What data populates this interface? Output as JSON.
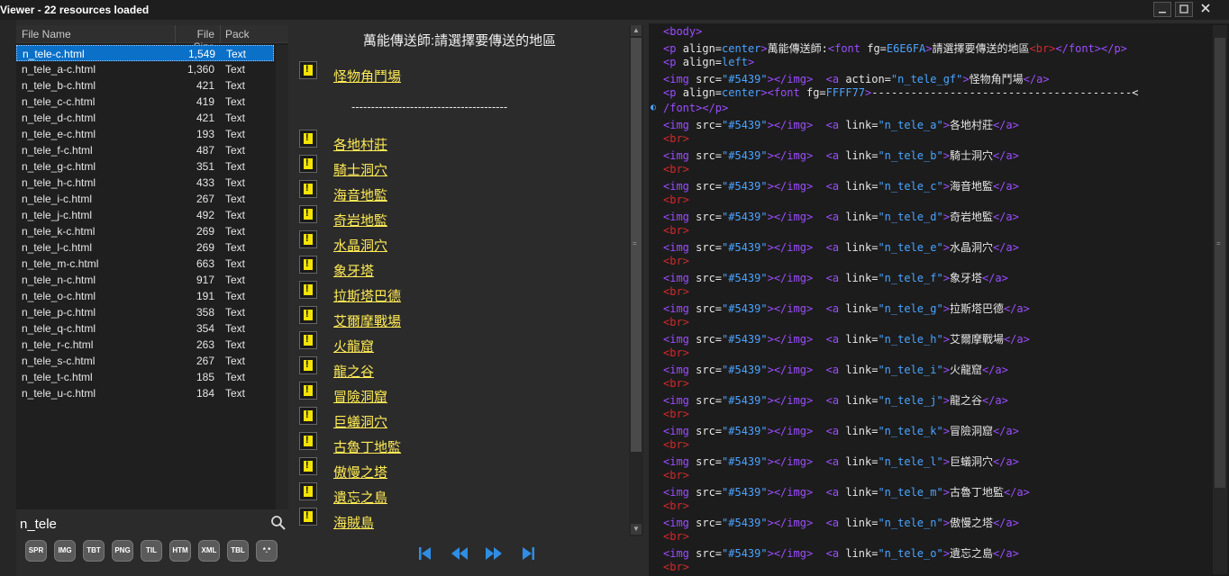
{
  "window": {
    "title": "Viewer - 22 resources loaded"
  },
  "file_list": {
    "columns": [
      "File Name",
      "File Size",
      "Pack"
    ],
    "rows": [
      {
        "name": "n_tele-c.html",
        "size": "1,549",
        "pack": "Text",
        "selected": true
      },
      {
        "name": "n_tele_a-c.html",
        "size": "1,360",
        "pack": "Text"
      },
      {
        "name": "n_tele_b-c.html",
        "size": "421",
        "pack": "Text"
      },
      {
        "name": "n_tele_c-c.html",
        "size": "419",
        "pack": "Text"
      },
      {
        "name": "n_tele_d-c.html",
        "size": "421",
        "pack": "Text"
      },
      {
        "name": "n_tele_e-c.html",
        "size": "193",
        "pack": "Text"
      },
      {
        "name": "n_tele_f-c.html",
        "size": "487",
        "pack": "Text"
      },
      {
        "name": "n_tele_g-c.html",
        "size": "351",
        "pack": "Text"
      },
      {
        "name": "n_tele_h-c.html",
        "size": "433",
        "pack": "Text"
      },
      {
        "name": "n_tele_i-c.html",
        "size": "267",
        "pack": "Text"
      },
      {
        "name": "n_tele_j-c.html",
        "size": "492",
        "pack": "Text"
      },
      {
        "name": "n_tele_k-c.html",
        "size": "269",
        "pack": "Text"
      },
      {
        "name": "n_tele_l-c.html",
        "size": "269",
        "pack": "Text"
      },
      {
        "name": "n_tele_m-c.html",
        "size": "663",
        "pack": "Text"
      },
      {
        "name": "n_tele_n-c.html",
        "size": "917",
        "pack": "Text"
      },
      {
        "name": "n_tele_o-c.html",
        "size": "191",
        "pack": "Text"
      },
      {
        "name": "n_tele_p-c.html",
        "size": "358",
        "pack": "Text"
      },
      {
        "name": "n_tele_q-c.html",
        "size": "354",
        "pack": "Text"
      },
      {
        "name": "n_tele_r-c.html",
        "size": "263",
        "pack": "Text"
      },
      {
        "name": "n_tele_s-c.html",
        "size": "267",
        "pack": "Text"
      },
      {
        "name": "n_tele_t-c.html",
        "size": "185",
        "pack": "Text"
      },
      {
        "name": "n_tele_u-c.html",
        "size": "184",
        "pack": "Text"
      }
    ]
  },
  "search": {
    "value": "n_tele"
  },
  "filters": [
    "SPR",
    "IMG",
    "TBT",
    "PNG",
    "TIL",
    "HTM",
    "XML",
    "TBL",
    "*.*"
  ],
  "preview": {
    "header": "萬能傳送師:請選擇要傳送的地區",
    "top_link": "怪物角鬥場",
    "separator": "----------------------------------------",
    "links": [
      "各地村莊",
      "騎士洞穴",
      "海音地監",
      "奇岩地監",
      "水晶洞穴",
      "象牙塔",
      "拉斯塔巴德",
      "艾爾摩戰場",
      "火龍窟",
      "龍之谷",
      "冒險洞窟",
      "巨蟻洞穴",
      "古魯丁地監",
      "傲慢之塔",
      "遺忘之島",
      "海賊島"
    ]
  },
  "source": {
    "lines": [
      [
        [
          "tg",
          "<body>"
        ]
      ],
      [
        [
          "tg",
          "<p "
        ],
        [
          "at",
          "align="
        ],
        [
          "st",
          "center"
        ],
        [
          "tg",
          ">"
        ],
        [
          "at",
          "萬能傳送師:"
        ],
        [
          "tg",
          "<font "
        ],
        [
          "at",
          "fg="
        ],
        [
          "st",
          "E6E6FA"
        ],
        [
          "tg",
          ">"
        ],
        [
          "at",
          "請選擇要傳送的地區"
        ],
        [
          "br",
          "<br>"
        ],
        [
          "tg",
          "</font></p>"
        ]
      ],
      [
        [
          "tg",
          "<p "
        ],
        [
          "at",
          "align="
        ],
        [
          "st",
          "left"
        ],
        [
          "tg",
          ">"
        ]
      ],
      [
        [
          "tg",
          "<img "
        ],
        [
          "at",
          "src="
        ],
        [
          "st",
          "\"#5439\""
        ],
        [
          "tg",
          "></img>"
        ],
        [
          "at",
          "  "
        ],
        [
          "tg",
          "<a "
        ],
        [
          "at",
          "action="
        ],
        [
          "st",
          "\"n_tele_gf\""
        ],
        [
          "tg",
          ">"
        ],
        [
          "at",
          "怪物角鬥場"
        ],
        [
          "tg",
          "</a>"
        ]
      ],
      [
        [
          "tg",
          "<p "
        ],
        [
          "at",
          "align="
        ],
        [
          "st",
          "center"
        ],
        [
          "tg",
          "><font "
        ],
        [
          "at",
          "fg="
        ],
        [
          "st",
          "FFFF77"
        ],
        [
          "tg",
          ">"
        ],
        [
          "at",
          "----------------------------------------<"
        ]
      ],
      [
        [
          "tg",
          "/font></p>"
        ]
      ],
      [
        [
          "tg",
          "<img "
        ],
        [
          "at",
          "src="
        ],
        [
          "st",
          "\"#5439\""
        ],
        [
          "tg",
          "></img>"
        ],
        [
          "at",
          "  "
        ],
        [
          "tg",
          "<a "
        ],
        [
          "at",
          "link="
        ],
        [
          "st",
          "\"n_tele_a\""
        ],
        [
          "tg",
          ">"
        ],
        [
          "at",
          "各地村莊"
        ],
        [
          "tg",
          "</a>"
        ]
      ],
      [
        [
          "br",
          "<br>"
        ]
      ],
      [
        [
          "tg",
          "<img "
        ],
        [
          "at",
          "src="
        ],
        [
          "st",
          "\"#5439\""
        ],
        [
          "tg",
          "></img>"
        ],
        [
          "at",
          "  "
        ],
        [
          "tg",
          "<a "
        ],
        [
          "at",
          "link="
        ],
        [
          "st",
          "\"n_tele_b\""
        ],
        [
          "tg",
          ">"
        ],
        [
          "at",
          "騎士洞穴"
        ],
        [
          "tg",
          "</a>"
        ]
      ],
      [
        [
          "br",
          "<br>"
        ]
      ],
      [
        [
          "tg",
          "<img "
        ],
        [
          "at",
          "src="
        ],
        [
          "st",
          "\"#5439\""
        ],
        [
          "tg",
          "></img>"
        ],
        [
          "at",
          "  "
        ],
        [
          "tg",
          "<a "
        ],
        [
          "at",
          "link="
        ],
        [
          "st",
          "\"n_tele_c\""
        ],
        [
          "tg",
          ">"
        ],
        [
          "at",
          "海音地監"
        ],
        [
          "tg",
          "</a>"
        ]
      ],
      [
        [
          "br",
          "<br>"
        ]
      ],
      [
        [
          "tg",
          "<img "
        ],
        [
          "at",
          "src="
        ],
        [
          "st",
          "\"#5439\""
        ],
        [
          "tg",
          "></img>"
        ],
        [
          "at",
          "  "
        ],
        [
          "tg",
          "<a "
        ],
        [
          "at",
          "link="
        ],
        [
          "st",
          "\"n_tele_d\""
        ],
        [
          "tg",
          ">"
        ],
        [
          "at",
          "奇岩地監"
        ],
        [
          "tg",
          "</a>"
        ]
      ],
      [
        [
          "br",
          "<br>"
        ]
      ],
      [
        [
          "tg",
          "<img "
        ],
        [
          "at",
          "src="
        ],
        [
          "st",
          "\"#5439\""
        ],
        [
          "tg",
          "></img>"
        ],
        [
          "at",
          "  "
        ],
        [
          "tg",
          "<a "
        ],
        [
          "at",
          "link="
        ],
        [
          "st",
          "\"n_tele_e\""
        ],
        [
          "tg",
          ">"
        ],
        [
          "at",
          "水晶洞穴"
        ],
        [
          "tg",
          "</a>"
        ]
      ],
      [
        [
          "br",
          "<br>"
        ]
      ],
      [
        [
          "tg",
          "<img "
        ],
        [
          "at",
          "src="
        ],
        [
          "st",
          "\"#5439\""
        ],
        [
          "tg",
          "></img>"
        ],
        [
          "at",
          "  "
        ],
        [
          "tg",
          "<a "
        ],
        [
          "at",
          "link="
        ],
        [
          "st",
          "\"n_tele_f\""
        ],
        [
          "tg",
          ">"
        ],
        [
          "at",
          "象牙塔"
        ],
        [
          "tg",
          "</a>"
        ]
      ],
      [
        [
          "br",
          "<br>"
        ]
      ],
      [
        [
          "tg",
          "<img "
        ],
        [
          "at",
          "src="
        ],
        [
          "st",
          "\"#5439\""
        ],
        [
          "tg",
          "></img>"
        ],
        [
          "at",
          "  "
        ],
        [
          "tg",
          "<a "
        ],
        [
          "at",
          "link="
        ],
        [
          "st",
          "\"n_tele_g\""
        ],
        [
          "tg",
          ">"
        ],
        [
          "at",
          "拉斯塔巴德"
        ],
        [
          "tg",
          "</a>"
        ]
      ],
      [
        [
          "br",
          "<br>"
        ]
      ],
      [
        [
          "tg",
          "<img "
        ],
        [
          "at",
          "src="
        ],
        [
          "st",
          "\"#5439\""
        ],
        [
          "tg",
          "></img>"
        ],
        [
          "at",
          "  "
        ],
        [
          "tg",
          "<a "
        ],
        [
          "at",
          "link="
        ],
        [
          "st",
          "\"n_tele_h\""
        ],
        [
          "tg",
          ">"
        ],
        [
          "at",
          "艾爾摩戰場"
        ],
        [
          "tg",
          "</a>"
        ]
      ],
      [
        [
          "br",
          "<br>"
        ]
      ],
      [
        [
          "tg",
          "<img "
        ],
        [
          "at",
          "src="
        ],
        [
          "st",
          "\"#5439\""
        ],
        [
          "tg",
          "></img>"
        ],
        [
          "at",
          "  "
        ],
        [
          "tg",
          "<a "
        ],
        [
          "at",
          "link="
        ],
        [
          "st",
          "\"n_tele_i\""
        ],
        [
          "tg",
          ">"
        ],
        [
          "at",
          "火龍窟"
        ],
        [
          "tg",
          "</a>"
        ]
      ],
      [
        [
          "br",
          "<br>"
        ]
      ],
      [
        [
          "tg",
          "<img "
        ],
        [
          "at",
          "src="
        ],
        [
          "st",
          "\"#5439\""
        ],
        [
          "tg",
          "></img>"
        ],
        [
          "at",
          "  "
        ],
        [
          "tg",
          "<a "
        ],
        [
          "at",
          "link="
        ],
        [
          "st",
          "\"n_tele_j\""
        ],
        [
          "tg",
          ">"
        ],
        [
          "at",
          "龍之谷"
        ],
        [
          "tg",
          "</a>"
        ]
      ],
      [
        [
          "br",
          "<br>"
        ]
      ],
      [
        [
          "tg",
          "<img "
        ],
        [
          "at",
          "src="
        ],
        [
          "st",
          "\"#5439\""
        ],
        [
          "tg",
          "></img>"
        ],
        [
          "at",
          "  "
        ],
        [
          "tg",
          "<a "
        ],
        [
          "at",
          "link="
        ],
        [
          "st",
          "\"n_tele_k\""
        ],
        [
          "tg",
          ">"
        ],
        [
          "at",
          "冒險洞窟"
        ],
        [
          "tg",
          "</a>"
        ]
      ],
      [
        [
          "br",
          "<br>"
        ]
      ],
      [
        [
          "tg",
          "<img "
        ],
        [
          "at",
          "src="
        ],
        [
          "st",
          "\"#5439\""
        ],
        [
          "tg",
          "></img>"
        ],
        [
          "at",
          "  "
        ],
        [
          "tg",
          "<a "
        ],
        [
          "at",
          "link="
        ],
        [
          "st",
          "\"n_tele_l\""
        ],
        [
          "tg",
          ">"
        ],
        [
          "at",
          "巨蟻洞穴"
        ],
        [
          "tg",
          "</a>"
        ]
      ],
      [
        [
          "br",
          "<br>"
        ]
      ],
      [
        [
          "tg",
          "<img "
        ],
        [
          "at",
          "src="
        ],
        [
          "st",
          "\"#5439\""
        ],
        [
          "tg",
          "></img>"
        ],
        [
          "at",
          "  "
        ],
        [
          "tg",
          "<a "
        ],
        [
          "at",
          "link="
        ],
        [
          "st",
          "\"n_tele_m\""
        ],
        [
          "tg",
          ">"
        ],
        [
          "at",
          "古魯丁地監"
        ],
        [
          "tg",
          "</a>"
        ]
      ],
      [
        [
          "br",
          "<br>"
        ]
      ],
      [
        [
          "tg",
          "<img "
        ],
        [
          "at",
          "src="
        ],
        [
          "st",
          "\"#5439\""
        ],
        [
          "tg",
          "></img>"
        ],
        [
          "at",
          "  "
        ],
        [
          "tg",
          "<a "
        ],
        [
          "at",
          "link="
        ],
        [
          "st",
          "\"n_tele_n\""
        ],
        [
          "tg",
          ">"
        ],
        [
          "at",
          "傲慢之塔"
        ],
        [
          "tg",
          "</a>"
        ]
      ],
      [
        [
          "br",
          "<br>"
        ]
      ],
      [
        [
          "tg",
          "<img "
        ],
        [
          "at",
          "src="
        ],
        [
          "st",
          "\"#5439\""
        ],
        [
          "tg",
          "></img>"
        ],
        [
          "at",
          "  "
        ],
        [
          "tg",
          "<a "
        ],
        [
          "at",
          "link="
        ],
        [
          "st",
          "\"n_tele_o\""
        ],
        [
          "tg",
          ">"
        ],
        [
          "at",
          "遺忘之島"
        ],
        [
          "tg",
          "</a>"
        ]
      ],
      [
        [
          "br",
          "<br>"
        ]
      ]
    ]
  },
  "colors": {
    "selection": "#0a70c8",
    "link": "#ffeb55",
    "tag": "#9b4dff",
    "string": "#4ba3ff",
    "br": "#d22a2a",
    "nav": "#2f8de4"
  },
  "icons": {
    "search": "search-icon",
    "minimize": "minimize-icon",
    "maximize": "maximize-icon",
    "close": "close-icon",
    "first": "skip-first-icon",
    "prev": "rewind-icon",
    "next": "fast-forward-icon",
    "last": "skip-last-icon"
  }
}
